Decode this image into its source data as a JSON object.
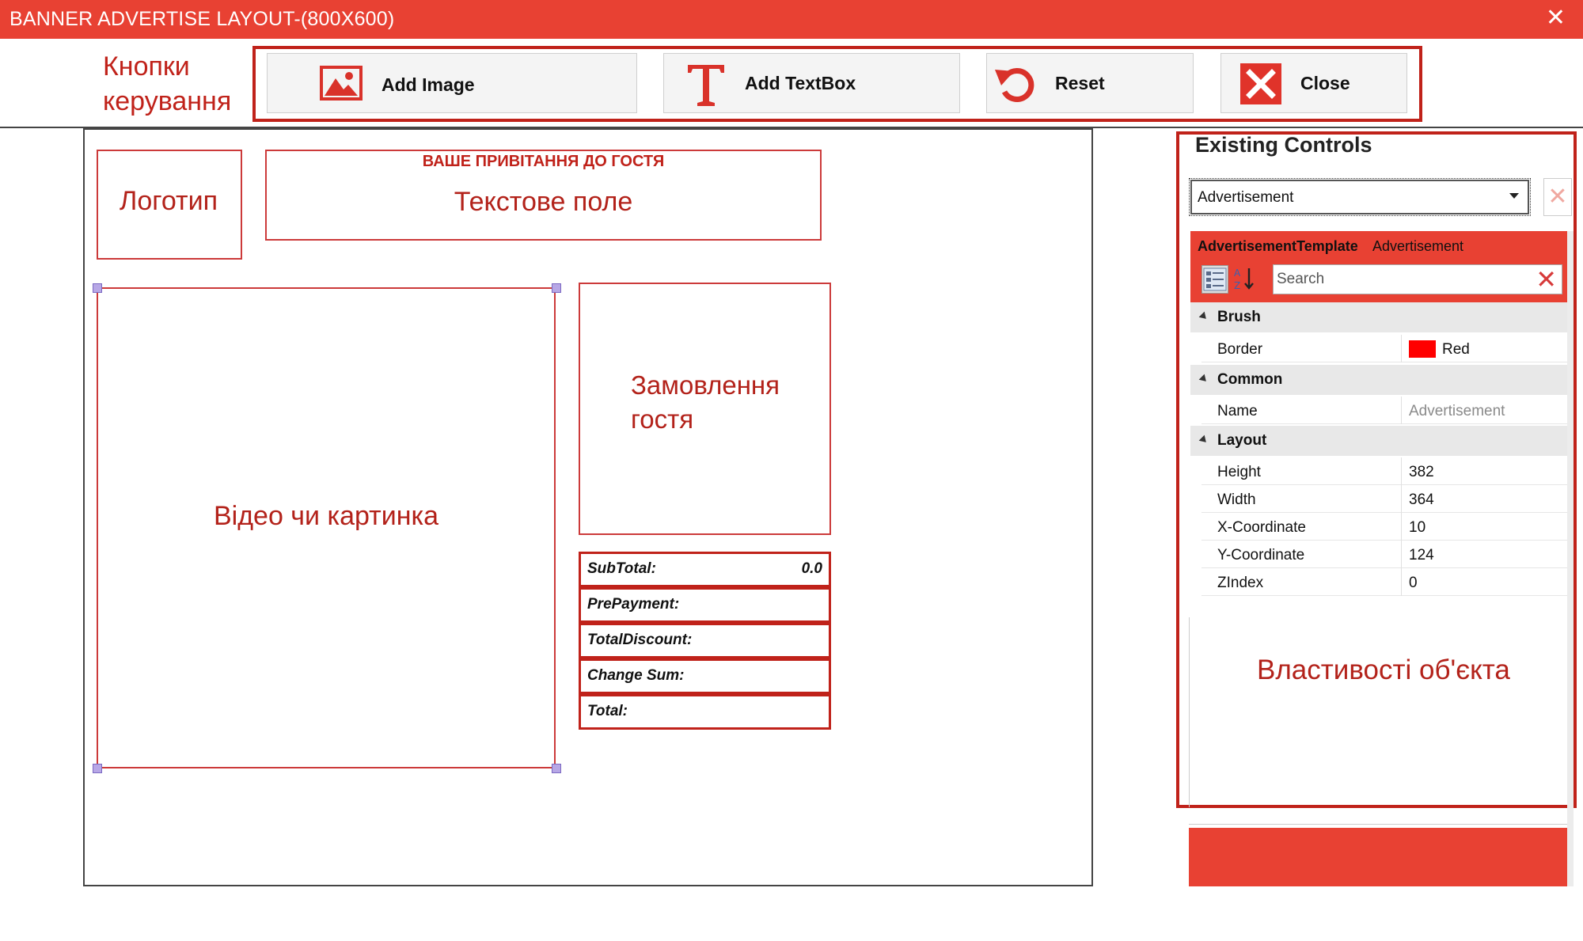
{
  "window": {
    "title": "BANNER ADVERTISE LAYOUT-(800X600)",
    "close_glyph": "✕"
  },
  "toolbar": {
    "annotation_line1": "Кнопки",
    "annotation_line2": "керування",
    "add_image": {
      "label": "Add Image",
      "icon": "image-icon"
    },
    "add_textbox": {
      "label": "Add TextBox",
      "icon": "text-t-icon"
    },
    "reset": {
      "label": "Reset",
      "icon": "undo-icon"
    },
    "close": {
      "label": "Close",
      "icon": "close-x-icon"
    }
  },
  "canvas": {
    "logo_label": "Логотип",
    "greeting_caption": "ВАШЕ ПРИВІТАННЯ ДО ГОСТЯ",
    "textbox_label": "Текстове поле",
    "media_label": "Відео чи картинка",
    "order_line1": "Замовлення",
    "order_line2": "гостя",
    "totals": [
      {
        "label": "SubTotal:",
        "value": "0.0"
      },
      {
        "label": "PrePayment:",
        "value": ""
      },
      {
        "label": "TotalDiscount:",
        "value": ""
      },
      {
        "label": "Change Sum:",
        "value": ""
      },
      {
        "label": "Total:",
        "value": ""
      }
    ]
  },
  "panel": {
    "title": "Existing Controls",
    "selected_control": "Advertisement",
    "remove_glyph": "✕",
    "object_type": "AdvertisementTemplate",
    "object_name": "Advertisement",
    "search_placeholder": "Search",
    "search_clear_glyph": "✕",
    "categories": {
      "brush": {
        "label": "Brush",
        "props": [
          {
            "name": "Border",
            "value": "Red",
            "swatch": "#ff0000"
          }
        ]
      },
      "common": {
        "label": "Common",
        "props": [
          {
            "name": "Name",
            "value": "Advertisement"
          }
        ]
      },
      "layout": {
        "label": "Layout",
        "props": [
          {
            "name": "Height",
            "value": "382"
          },
          {
            "name": "Width",
            "value": "364"
          },
          {
            "name": "X-Coordinate",
            "value": "10"
          },
          {
            "name": "Y-Coordinate",
            "value": "124"
          },
          {
            "name": "ZIndex",
            "value": "0"
          }
        ]
      }
    },
    "annotation": "Властивості об'єкта"
  },
  "colors": {
    "accent": "#e84133",
    "annotation_red": "#c0221a",
    "border_swatch": "#ff0000"
  }
}
